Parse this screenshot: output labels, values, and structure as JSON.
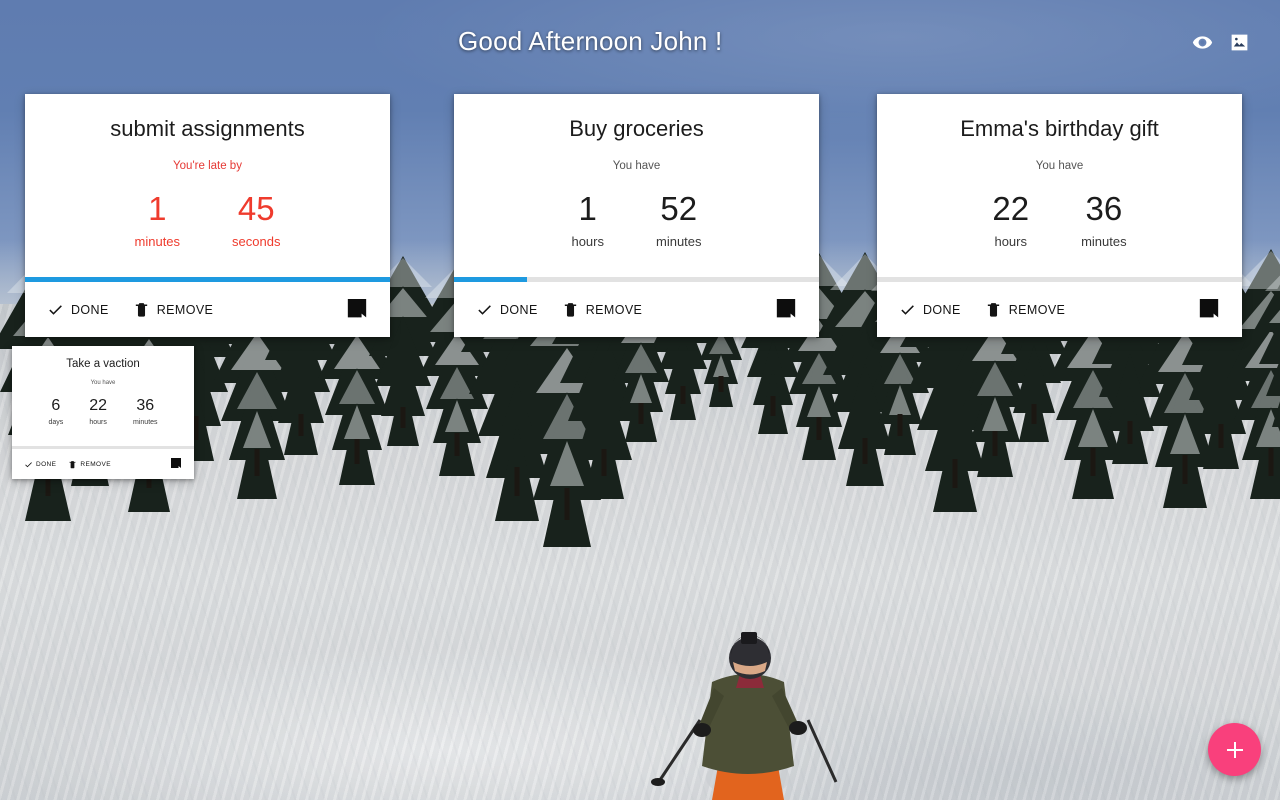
{
  "header": {
    "greeting": "Good Afternoon John !",
    "icons": [
      {
        "name": "visibility-icon",
        "label": "Toggle visibility"
      },
      {
        "name": "image-icon",
        "label": "Change background image"
      }
    ]
  },
  "colors": {
    "accent_blue": "#1e9ae0",
    "late_red": "#ef3b2d",
    "fab_pink": "#f9407c",
    "card_bg": "#ffffff",
    "progress_track": "#e2e2e2"
  },
  "actions": {
    "done_label": "DONE",
    "remove_label": "REMOVE",
    "flag_name": "bookmark-icon"
  },
  "fab": {
    "label": "+",
    "name": "add-task-button"
  },
  "tasks": [
    {
      "id": "card1",
      "title": "submit assignments",
      "subtitle": "You're late by",
      "late": true,
      "progress_percent": 100,
      "units": [
        {
          "value": "1",
          "label": "minutes"
        },
        {
          "value": "45",
          "label": "seconds"
        }
      ]
    },
    {
      "id": "card2",
      "title": "Buy groceries",
      "subtitle": "You have",
      "late": false,
      "progress_percent": 20,
      "units": [
        {
          "value": "1",
          "label": "hours"
        },
        {
          "value": "52",
          "label": "minutes"
        }
      ]
    },
    {
      "id": "card3",
      "title": "Emma's birthday gift",
      "subtitle": "You have",
      "late": false,
      "progress_percent": 0,
      "units": [
        {
          "value": "22",
          "label": "hours"
        },
        {
          "value": "36",
          "label": "minutes"
        }
      ]
    },
    {
      "id": "card4",
      "title": "Take a vaction",
      "subtitle": "You have",
      "late": false,
      "progress_percent": 0,
      "units": [
        {
          "value": "6",
          "label": "days"
        },
        {
          "value": "22",
          "label": "hours"
        },
        {
          "value": "36",
          "label": "minutes"
        }
      ]
    }
  ]
}
